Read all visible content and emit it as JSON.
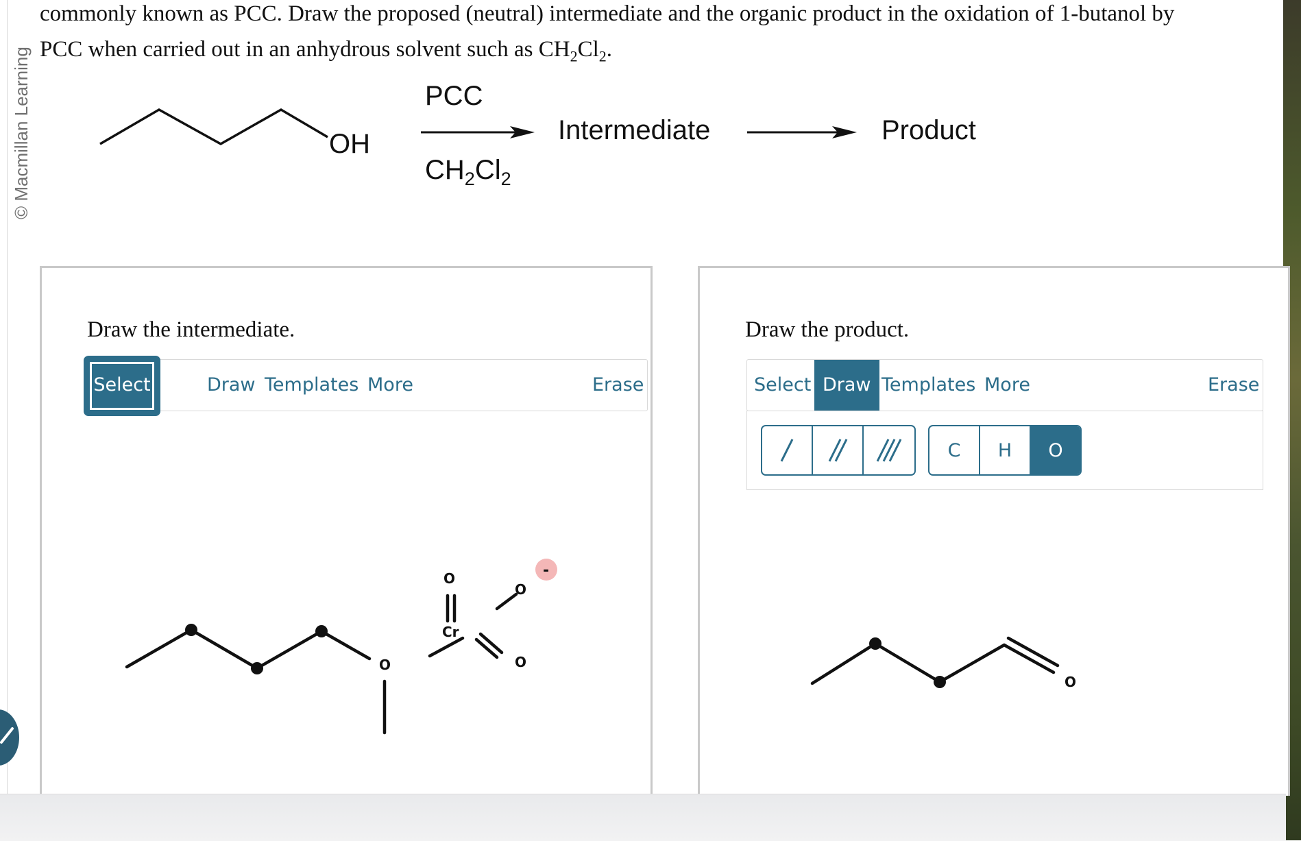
{
  "question": {
    "line1": "commonly known as PCC. Draw the proposed (neutral) intermediate and the organic product in the oxidation of 1-butanol by",
    "line2_prefix": "PCC when carried out in an anhydrous solvent such as CH",
    "line2_sub1": "2",
    "line2_mid": "Cl",
    "line2_sub2": "2",
    "line2_suffix": "."
  },
  "copyright": "© Macmillan Learning",
  "scheme": {
    "reactant_label": "OH",
    "reagent_top": "PCC",
    "reagent_bottom_prefix": "CH",
    "reagent_bottom_sub1": "2",
    "reagent_bottom_mid": "Cl",
    "reagent_bottom_sub2": "2",
    "intermediate_label": "Intermediate",
    "product_label": "Product"
  },
  "left_panel": {
    "title": "Draw the intermediate.",
    "toolbar": {
      "select": "Select",
      "draw": "Draw",
      "templates": "Templates",
      "more": "More",
      "erase": "Erase",
      "active": "Select"
    },
    "molecule_atoms": {
      "o_top": "O",
      "cr": "Cr",
      "o_right": "O",
      "o_bottom_right": "O",
      "o_ester": "O",
      "charge": "-"
    }
  },
  "right_panel": {
    "title": "Draw the product.",
    "toolbar": {
      "select": "Select",
      "draw": "Draw",
      "templates": "Templates",
      "more": "More",
      "erase": "Erase",
      "active": "Draw"
    },
    "bond_tools": [
      "single-bond",
      "double-bond",
      "triple-bond"
    ],
    "atom_tools": [
      "C",
      "H",
      "O"
    ],
    "active_atom": "O",
    "molecule_atoms": {
      "o_carbonyl": "O"
    }
  },
  "colors": {
    "accent": "#2c6d8a",
    "charge_badge": "#f4b7b7"
  }
}
